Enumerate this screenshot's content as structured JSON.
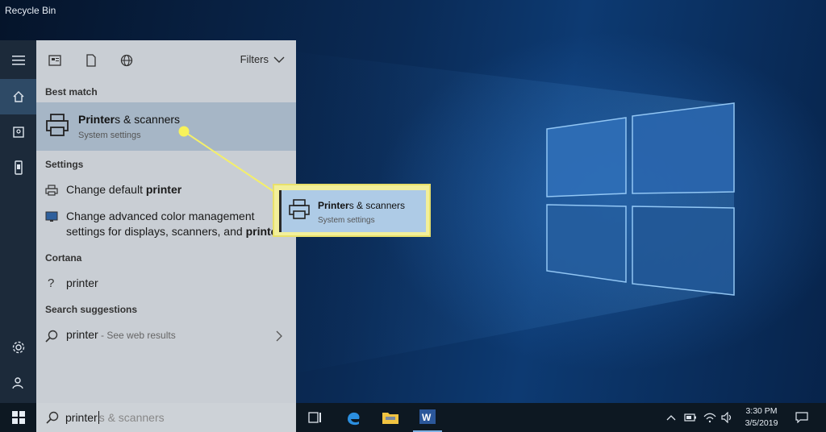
{
  "desktop": {
    "recycle_bin_label": "Recycle Bin"
  },
  "colors": {
    "panel_bg": "#c9ced4",
    "best_match_highlight": "#a6b6c6",
    "callout_border": "#f2ef9a",
    "callout_bg": "#aecbe6",
    "taskbar_bg": "#0d1822"
  },
  "start_rail": {
    "items": [
      {
        "icon": "hamburger-icon"
      },
      {
        "icon": "home-icon"
      },
      {
        "icon": "documents-icon"
      },
      {
        "icon": "phone-icon"
      },
      {
        "icon": "settings-gear-icon"
      },
      {
        "icon": "user-icon"
      }
    ]
  },
  "search_panel": {
    "filters_label": "Filters",
    "sections": {
      "best_match": "Best match",
      "settings": "Settings",
      "cortana": "Cortana",
      "search_suggestions": "Search suggestions"
    },
    "best_match": {
      "title_bold": "Printer",
      "title_rest": "s & scanners",
      "subtitle": "System settings"
    },
    "settings_items": [
      {
        "prefix": "Change default ",
        "bold": "printer"
      },
      {
        "line1": "Change advanced color management",
        "line2_prefix": "settings for displays, scanners, and ",
        "line2_bold": "printe"
      }
    ],
    "cortana_item": "printer",
    "suggestion": {
      "bold": "printer",
      "dim": " - See web results"
    }
  },
  "callout": {
    "title_bold": "Printer",
    "title_rest": "s & scanners",
    "subtitle": "System settings"
  },
  "taskbar": {
    "search_query": "printer",
    "search_suggestion": "s & scanners",
    "clock_time": "3:30 PM",
    "clock_date": "3/5/2019"
  }
}
